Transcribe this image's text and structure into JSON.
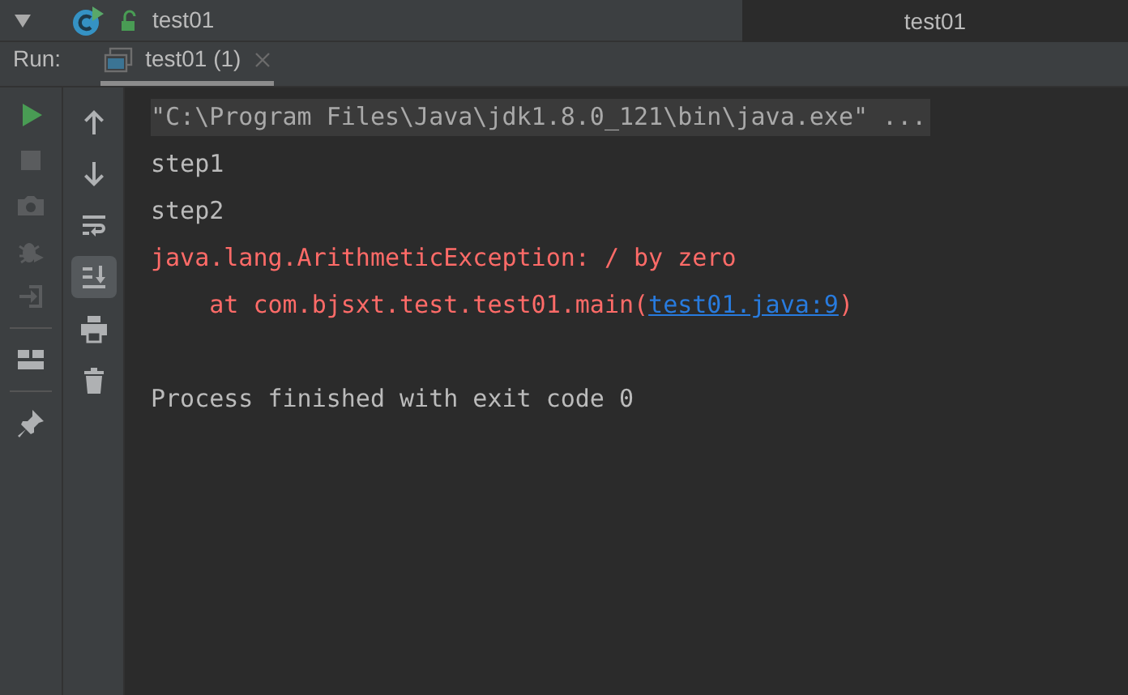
{
  "header": {
    "expanded": true,
    "title": "test01",
    "right_title": "test01"
  },
  "run_bar": {
    "label": "Run:",
    "tabs": [
      {
        "label": "test01 (1)",
        "selected": true
      }
    ]
  },
  "left_toolbar": [
    {
      "kind": "run",
      "disabled": false
    },
    {
      "kind": "stop",
      "disabled": true
    },
    {
      "kind": "camera",
      "disabled": true
    },
    {
      "kind": "bug",
      "disabled": true
    },
    {
      "kind": "exit",
      "disabled": true
    },
    {
      "kind": "divider"
    },
    {
      "kind": "layout",
      "disabled": false
    },
    {
      "kind": "divider"
    },
    {
      "kind": "pin",
      "disabled": false
    }
  ],
  "console_toolbar": [
    {
      "kind": "up",
      "on": false
    },
    {
      "kind": "down",
      "on": false
    },
    {
      "kind": "wrap",
      "on": false
    },
    {
      "kind": "scroll-end",
      "on": true
    },
    {
      "kind": "print",
      "on": false
    },
    {
      "kind": "trash",
      "on": false
    }
  ],
  "console": [
    {
      "kind": "command",
      "text": "\"C:\\Program Files\\Java\\jdk1.8.0_121\\bin\\java.exe\" ..."
    },
    {
      "kind": "output",
      "text": "step1"
    },
    {
      "kind": "output",
      "text": "step2"
    },
    {
      "kind": "error",
      "text": "java.lang.ArithmeticException: / by zero"
    },
    {
      "kind": "trace",
      "text": "    at com.bjsxt.test.test01.main(",
      "link": "test01.java:9",
      "after": ")"
    },
    {
      "kind": "blank"
    },
    {
      "kind": "output",
      "text": "Process finished with exit code 0"
    }
  ]
}
